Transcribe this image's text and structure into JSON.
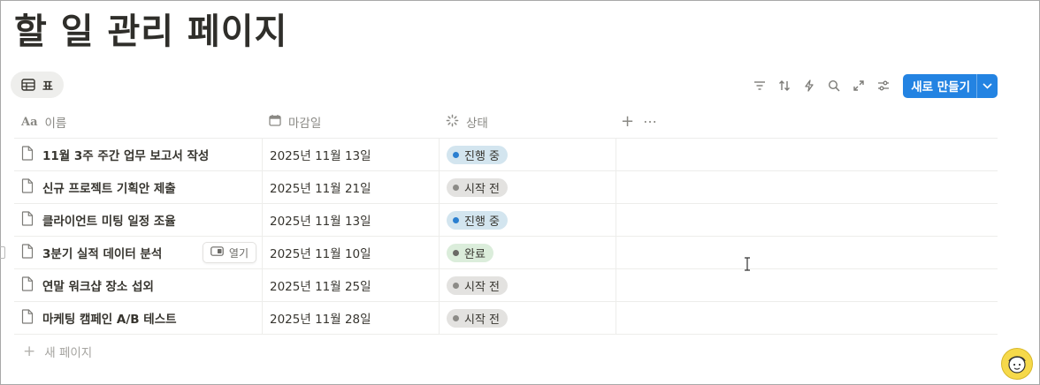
{
  "page": {
    "title": "할 일 관리 페이지"
  },
  "view_tab": {
    "label": "표",
    "icon": "table-icon"
  },
  "toolbar": {
    "icons": [
      "filter-icon",
      "sort-icon",
      "automation-bolt-icon",
      "search-icon",
      "expand-icon",
      "settings-sliders-icon"
    ],
    "new_button_label": "새로 만들기"
  },
  "columns": {
    "name": {
      "label": "이름",
      "icon": "text-aa-icon"
    },
    "due": {
      "label": "마감일",
      "icon": "calendar-icon"
    },
    "status": {
      "label": "상태",
      "icon": "status-spinner-icon"
    }
  },
  "status_colors": {
    "진행 중": {
      "bg": "#d3e5ef",
      "dot": "#2b7fd0"
    },
    "시작 전": {
      "bg": "#e3e2e0",
      "dot": "#8c8b87"
    },
    "완료": {
      "bg": "#dbeddb",
      "dot": "#6a6965"
    }
  },
  "rows": [
    {
      "name": "11월 3주 주간 업무 보고서 작성",
      "due": "2025년 11월 13일",
      "status": "진행 중"
    },
    {
      "name": "신규 프로젝트 기획안 제출",
      "due": "2025년 11월 21일",
      "status": "시작 전"
    },
    {
      "name": "클라이언트 미팅 일정 조율",
      "due": "2025년 11월 13일",
      "status": "진행 중"
    },
    {
      "name": "3분기 실적 데이터 분석",
      "due": "2025년 11월 10일",
      "status": "완료",
      "open_label": "열기"
    },
    {
      "name": "연말 워크샵 장소 섭외",
      "due": "2025년 11월 25일",
      "status": "시작 전"
    },
    {
      "name": "마케팅 캠페인 A/B 테스트",
      "due": "2025년 11월 28일",
      "status": "시작 전"
    }
  ],
  "new_page_label": "새 페이지"
}
